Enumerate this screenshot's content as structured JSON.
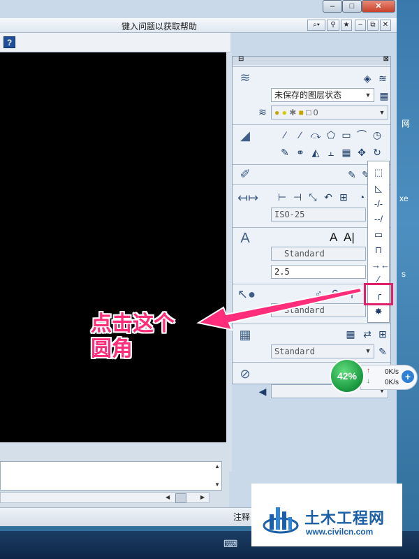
{
  "window": {
    "help_search_placeholder": "键入问题以获取帮助",
    "help_button": "?",
    "status_label": "注释"
  },
  "layers": {
    "layer_state": "未保存的图层状态",
    "current_layer": "0"
  },
  "dimension": {
    "dim_style": "ISO-25"
  },
  "text": {
    "text_style": "Standard",
    "text_height": "2.5",
    "big_a": "A"
  },
  "leader": {
    "leader_style": "Standard"
  },
  "table": {
    "table_style": "Standard"
  },
  "annotation": {
    "line1": "点击这个",
    "line2": "圆角"
  },
  "net_monitor": {
    "percent": "42%",
    "up": "0K/s",
    "down": "0K/s"
  },
  "desktop_side_labels": {
    "label1": "网",
    "label2": "xe",
    "label3": "s"
  },
  "watermark": {
    "title": "土木工程网",
    "url": "www.civilcn.com"
  },
  "colors": {
    "annotation": "#ff2d7a",
    "highlight_box": "#e0206a",
    "canvas": "#000000",
    "watermark_blue": "#1a5fa8"
  }
}
